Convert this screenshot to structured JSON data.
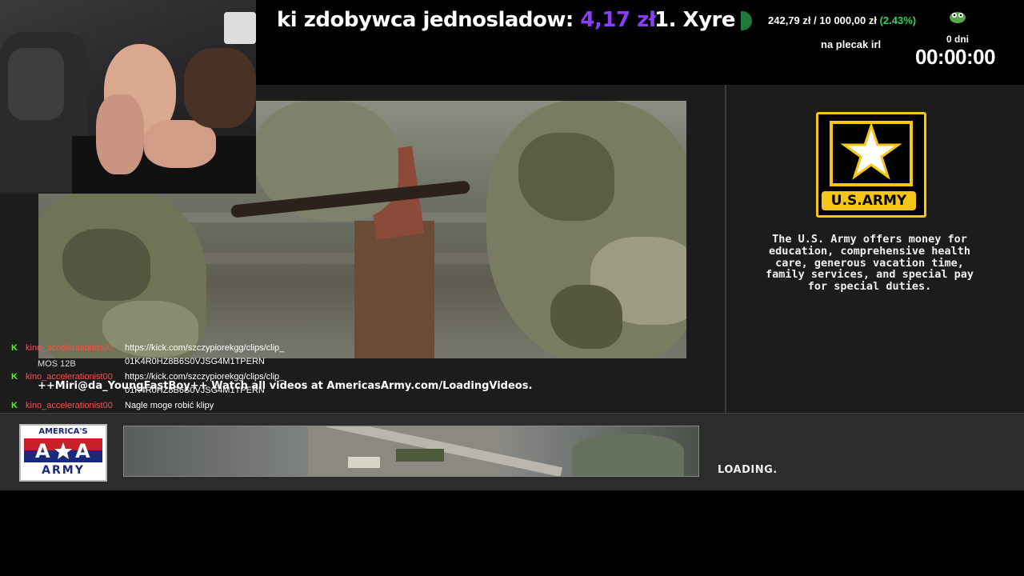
{
  "ticker": {
    "segment1_text": "ki zdobywca jednosladow:",
    "segment1_amount": "4,17 zł",
    "segment2_text": "1. Xyre"
  },
  "goal": {
    "progress_current": "242,79 zł",
    "progress_separator": "/",
    "progress_target": "10 000,00 zł",
    "progress_percent": "(2.43%)",
    "progress_fraction": 0.0243,
    "label": "na plecak irl",
    "days": "0 dni",
    "timer": "00:00:00"
  },
  "game": {
    "army_logo_text": "U.S.ARMY",
    "army_description": "The U.S. Army offers money for education, comprehensive health care, generous vacation time, family services, and special pay for special duties.",
    "video_caption": "MOS 12B",
    "watch_text": "Watch all videos at AmericasArmy.com/LoadingVideos.",
    "loading_text": "LOADING.",
    "aa_logo_top": "AMERICA'S",
    "aa_logo_bottom": "ARMY"
  },
  "chat": {
    "overlay_name": "++Miri@da_YoungFastBoy++",
    "messages": [
      {
        "platform_icon": "kick-icon",
        "username": "kino_accelerationist00",
        "text_line1": "https://kick.com/szczypiorekgg/clips/clip_",
        "text_line2": "01K4R0HZ8B6S0VJSG4M1TPERN"
      },
      {
        "platform_icon": "kick-icon",
        "username": "kino_accelerationist00",
        "text_line1": "https://kick.com/szczypiorekgg/clips/clip_",
        "text_line2": "01K4R0HZ8B6S0VJSG4M1TPERN"
      },
      {
        "platform_icon": "kick-icon",
        "username": "kino_accelerationist00",
        "text_line1": "Nagle moge robić klipy",
        "text_line2": ""
      }
    ]
  },
  "colors": {
    "ticker_amount": "#8a3cff",
    "goal_percent": "#2fd35b",
    "kick_green": "#53fc18",
    "username_red": "#ff4d4d",
    "army_gold": "#f5c518"
  }
}
